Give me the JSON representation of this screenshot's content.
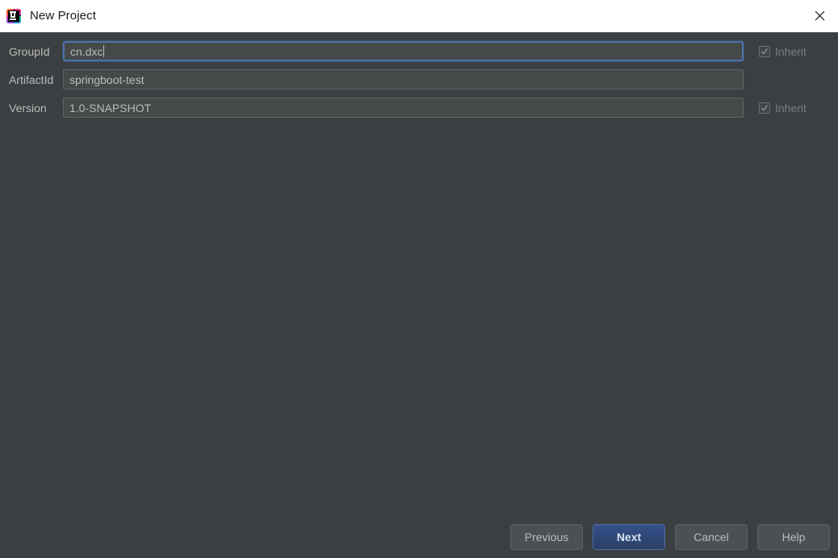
{
  "window": {
    "title": "New Project",
    "logo_icon": "intellij-idea-logo",
    "close_icon": "close-icon"
  },
  "form": {
    "fields": [
      {
        "label": "GroupId",
        "value": "cn.dxc",
        "focused": true,
        "has_inherit": true,
        "inherit_label": "Inherit",
        "inherit_checked": true,
        "inherit_enabled": false
      },
      {
        "label": "ArtifactId",
        "value": "springboot-test",
        "focused": false,
        "has_inherit": false,
        "inherit_label": "",
        "inherit_checked": false,
        "inherit_enabled": false
      },
      {
        "label": "Version",
        "value": "1.0-SNAPSHOT",
        "focused": false,
        "has_inherit": true,
        "inherit_label": "Inherit",
        "inherit_checked": true,
        "inherit_enabled": false
      }
    ]
  },
  "footer": {
    "buttons": [
      {
        "label": "Previous",
        "default": false
      },
      {
        "label": "Next",
        "default": true
      },
      {
        "label": "Cancel",
        "default": false
      },
      {
        "label": "Help",
        "default": false
      }
    ]
  },
  "colors": {
    "background": "#3c3f41",
    "titlebar": "#ffffff",
    "field_background": "#45494a",
    "focus_border": "#4b72ab",
    "default_button": "#2d4a7c",
    "text": "#bbbbbb",
    "disabled_text": "#7b7f81"
  }
}
